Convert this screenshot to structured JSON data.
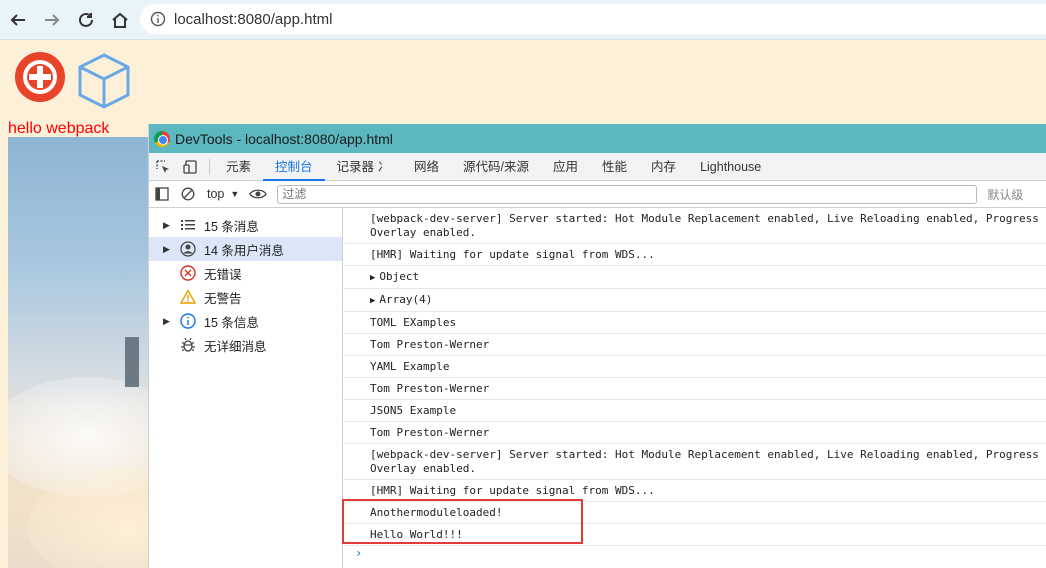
{
  "browser": {
    "url": "localhost:8080/app.html"
  },
  "page": {
    "hello_text": "hello webpack"
  },
  "devtools": {
    "title": "DevTools - localhost:8080/app.html",
    "tabs": [
      "元素",
      "控制台",
      "记录器 ⼎",
      "网络",
      "源代码/来源",
      "应用",
      "性能",
      "内存",
      "Lighthouse"
    ],
    "active_tab": "控制台",
    "toolbar": {
      "context": "top",
      "filter_placeholder": "过滤",
      "levels": "默认级"
    },
    "sidebar": [
      {
        "label": "15 条消息",
        "icon": "list-icon",
        "expandable": true
      },
      {
        "label": "14 条用户消息",
        "icon": "user-icon",
        "expandable": true,
        "selected": true
      },
      {
        "label": "无错误",
        "icon": "error-icon",
        "expandable": false
      },
      {
        "label": "无警告",
        "icon": "warning-icon",
        "expandable": false
      },
      {
        "label": "15 条信息",
        "icon": "info-icon",
        "expandable": true
      },
      {
        "label": "无详细消息",
        "icon": "bug-icon",
        "expandable": false
      }
    ],
    "console": [
      "[webpack-dev-server] Server started: Hot Module Replacement enabled, Live Reloading enabled, Progress d\nOverlay enabled.",
      "[HMR] Waiting for update signal from WDS...",
      "Object",
      "Array(4)",
      "TOML EXamples",
      "Tom Preston-Werner",
      "YAML Example",
      "Tom Preston-Werner",
      "JSON5 Example",
      "Tom Preston-Werner",
      "[webpack-dev-server] Server started: Hot Module Replacement enabled, Live Reloading enabled, Progress d\nOverlay enabled.",
      "[HMR] Waiting for update signal from WDS...",
      "Anothermoduleloaded!",
      "Hello World!!!"
    ]
  },
  "colors": {
    "highlight": "#e03c3c",
    "accent": "#1a73e8",
    "titlebar": "#5cb8bf"
  }
}
